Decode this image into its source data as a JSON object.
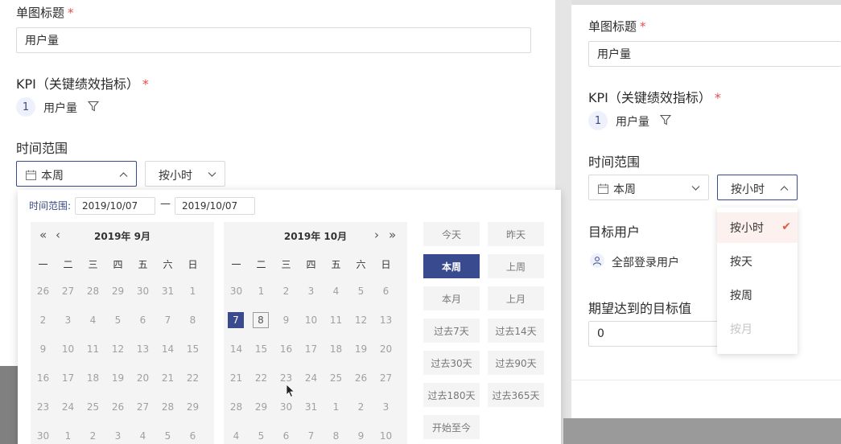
{
  "left": {
    "title_label": "单图标题",
    "required_mark": "*",
    "title_value": "用户量",
    "kpi_label": "KPI（关键绩效指标）",
    "kpi_index": "1",
    "kpi_name": "用户量",
    "time_range_label": "时间范围",
    "range_select": "本周",
    "granularity_select": "按小时"
  },
  "picker": {
    "range_label": "时间范围:",
    "start_date": "2019/10/07",
    "separator": "—",
    "end_date": "2019/10/07",
    "prev_year": "«",
    "prev_month": "‹",
    "next_month": "›",
    "next_year": "»",
    "weekdays": [
      "一",
      "二",
      "三",
      "四",
      "五",
      "六",
      "日"
    ],
    "left_month": {
      "title": "2019年 9月",
      "rows": [
        [
          "26",
          "27",
          "28",
          "29",
          "30",
          "31",
          "1"
        ],
        [
          "2",
          "3",
          "4",
          "5",
          "6",
          "7",
          "8"
        ],
        [
          "9",
          "10",
          "11",
          "12",
          "13",
          "14",
          "15"
        ],
        [
          "16",
          "17",
          "18",
          "19",
          "20",
          "21",
          "22"
        ],
        [
          "23",
          "24",
          "25",
          "26",
          "27",
          "28",
          "29"
        ],
        [
          "30",
          "1",
          "2",
          "3",
          "4",
          "5",
          "6"
        ]
      ]
    },
    "right_month": {
      "title": "2019年 10月",
      "rows": [
        [
          "30",
          "1",
          "2",
          "3",
          "4",
          "5",
          "6"
        ],
        [
          "7",
          "8",
          "9",
          "10",
          "11",
          "12",
          "13"
        ],
        [
          "14",
          "15",
          "16",
          "17",
          "18",
          "19",
          "20"
        ],
        [
          "21",
          "22",
          "23",
          "24",
          "25",
          "26",
          "27"
        ],
        [
          "28",
          "29",
          "30",
          "31",
          "1",
          "2",
          "3"
        ],
        [
          "4",
          "5",
          "6",
          "7",
          "8",
          "9",
          "10"
        ]
      ]
    },
    "quick_options": [
      [
        "今天",
        "昨天"
      ],
      [
        "本周",
        "上周"
      ],
      [
        "本月",
        "上月"
      ],
      [
        "过去7天",
        "过去14天"
      ],
      [
        "过去30天",
        "过去90天"
      ],
      [
        "过去180天",
        "过去365天"
      ],
      [
        "开始至今",
        ""
      ]
    ],
    "active_quick": "本周"
  },
  "right": {
    "title_label": "单图标题",
    "required_mark": "*",
    "title_value": "用户量",
    "kpi_label": "KPI（关键绩效指标）",
    "kpi_index": "1",
    "kpi_name": "用户量",
    "time_range_label": "时间范围",
    "range_select": "本周",
    "granularity_select": "按小时",
    "target_users_label": "目标用户",
    "target_users_value": "全部登录用户",
    "goal_label": "期望达到的目标值",
    "goal_value": "0",
    "granularity_options": [
      {
        "label": "按小时",
        "selected": true,
        "disabled": false
      },
      {
        "label": "按天",
        "selected": false,
        "disabled": false
      },
      {
        "label": "按周",
        "selected": false,
        "disabled": false
      },
      {
        "label": "按月",
        "selected": false,
        "disabled": true
      }
    ]
  },
  "colors": {
    "accent": "#3a4a8f",
    "required": "#e34d4d",
    "check": "#e05a47"
  }
}
